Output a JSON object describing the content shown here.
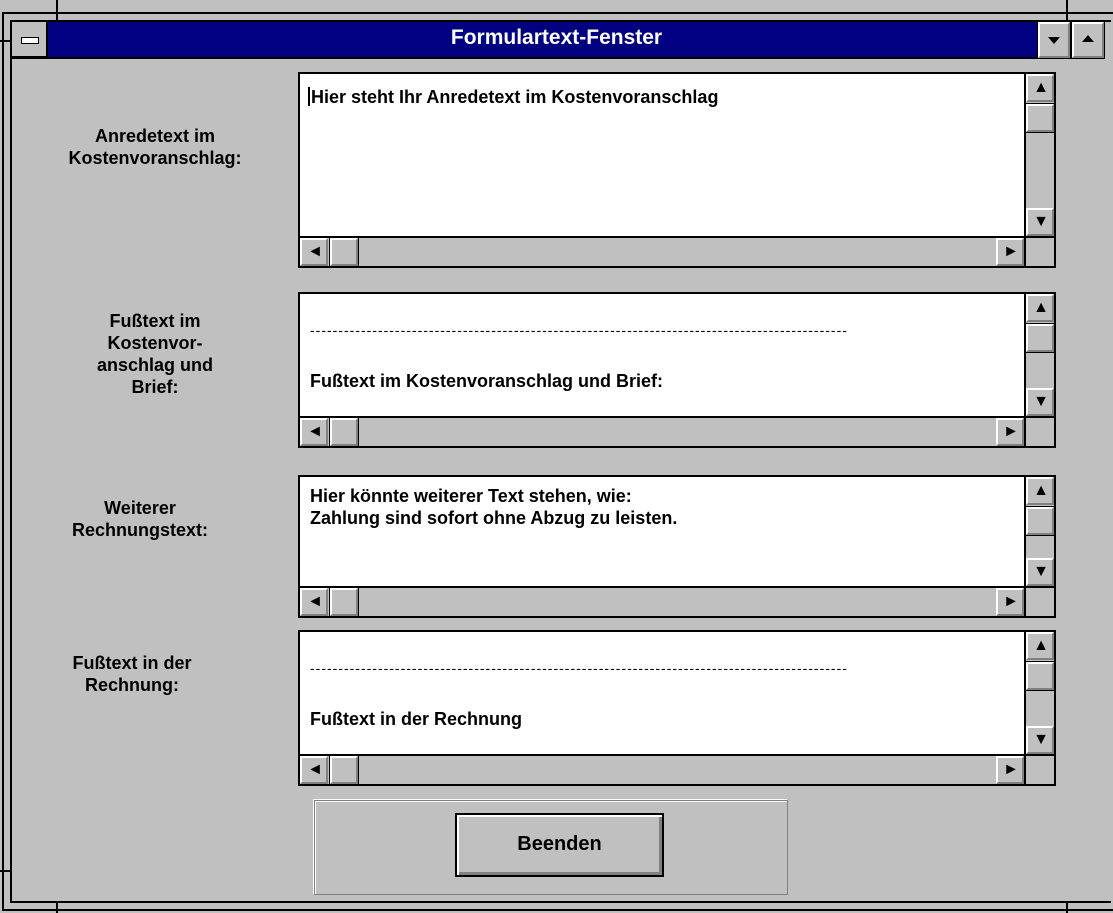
{
  "window": {
    "title": "Formulartext-Fenster",
    "system_menu_icon": "system-menu-icon",
    "minimize_icon": "minimize-icon",
    "maximize_icon": "maximize-icon"
  },
  "fields": [
    {
      "label": "Anredetext im\nKostenvoranschlag:",
      "value": "Hier steht Ihr Anredetext im Kostenvoranschlag"
    },
    {
      "label": "Fußtext im\nKostenvor-\nanschlag und\nBrief:",
      "separator": "-----------------------------------------------------------------------------------------------",
      "value": "Fußtext im Kostenvoranschlag und Brief:"
    },
    {
      "label": "Weiterer\nRechnungstext:",
      "value": "Hier könnte weiterer Text stehen, wie:\nZahlung sind sofort ohne Abzug zu leisten."
    },
    {
      "label": "Fußtext in der\nRechnung:",
      "separator": "-----------------------------------------------------------------------------------------------",
      "value": "Fußtext in der Rechnung"
    }
  ],
  "buttons": {
    "close_label": "Beenden"
  },
  "icons": {
    "up": "▲",
    "down": "▼",
    "left": "◄",
    "right": "►"
  }
}
